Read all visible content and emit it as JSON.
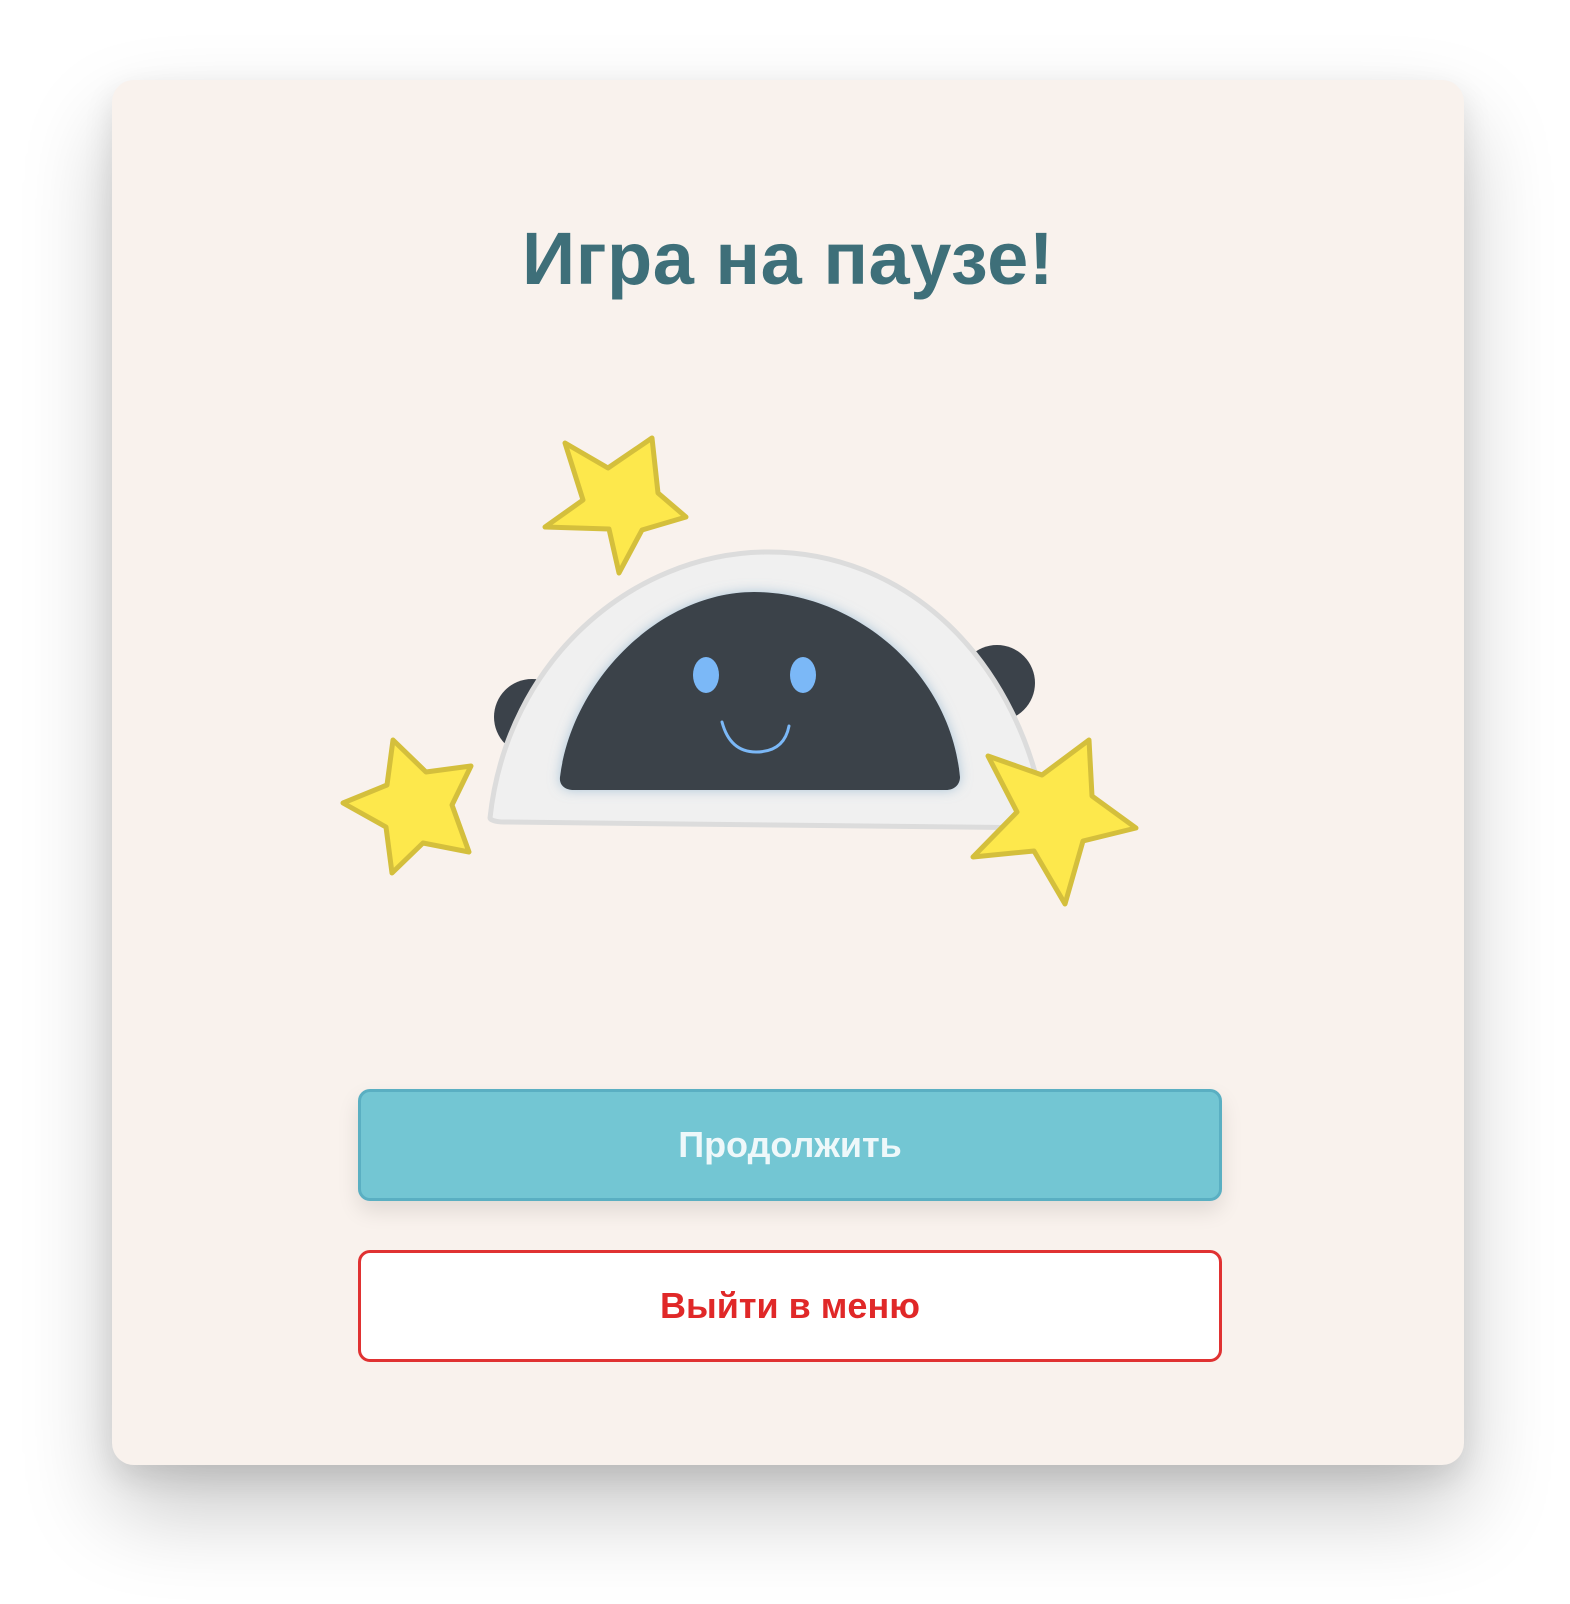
{
  "pause_dialog": {
    "title": "Игра на паузе!",
    "continue_label": "Продолжить",
    "exit_label": "Выйти в меню"
  },
  "illustration": {
    "icon": "smiling-robot-icon",
    "decorations": [
      "star-icon",
      "star-icon",
      "star-icon"
    ]
  },
  "colors": {
    "background": "#f9f2ed",
    "title": "#3e6f79",
    "continue_button": "#73c6d3",
    "exit_button_border": "#e03232",
    "star_fill": "#fde84c",
    "star_stroke": "#d4bf3c",
    "robot_face": "#3b424a",
    "robot_eyes": "#7bb8f7"
  }
}
